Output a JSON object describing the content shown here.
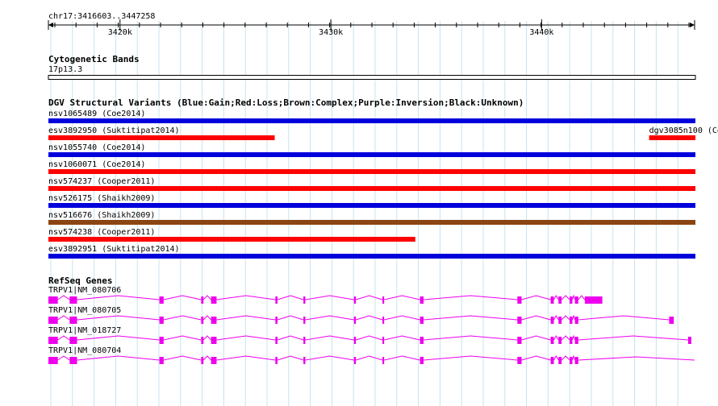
{
  "locus": {
    "label": "chr17:3416603..3447258",
    "start": 3416603,
    "end": 3447258
  },
  "ruler": {
    "ticks": [
      {
        "label": "3420k",
        "pos": 3420000
      },
      {
        "label": "3430k",
        "pos": 3430000
      },
      {
        "label": "3440k",
        "pos": 3440000
      }
    ]
  },
  "cytoband": {
    "title": "Cytogenetic Bands",
    "band": "17p13.3"
  },
  "dgv": {
    "title": "DGV Structural Variants (Blue:Gain;Red:Loss;Brown:Complex;Purple:Inversion;Black:Unknown)",
    "legend_colors": {
      "gain": "#0000dd",
      "loss": "#ff0000",
      "complex": "#8b4513",
      "inversion": "#800080",
      "unknown": "#000000"
    },
    "variants": [
      {
        "label": "nsv1065489 (Coe2014)",
        "type": "gain",
        "start": 3416603,
        "end": 3447258
      },
      {
        "label": "esv3892950 (Suktitipat2014)",
        "type": "loss",
        "start": 3416603,
        "end": 3427300
      },
      {
        "label": "dgv3085n100 (Co",
        "type": "loss",
        "start": 3445100,
        "end": 3447258
      },
      {
        "label": "nsv1055740 (Coe2014)",
        "type": "gain",
        "start": 3416603,
        "end": 3447258
      },
      {
        "label": "nsv1060071 (Coe2014)",
        "type": "loss",
        "start": 3416603,
        "end": 3447258
      },
      {
        "label": "nsv574237 (Cooper2011)",
        "type": "loss",
        "start": 3416603,
        "end": 3447258
      },
      {
        "label": "nsv526175 (Shaikh2009)",
        "type": "gain",
        "start": 3416603,
        "end": 3447258
      },
      {
        "label": "nsv516676 (Shaikh2009)",
        "type": "complex",
        "start": 3416603,
        "end": 3447258
      },
      {
        "label": "nsv574238 (Cooper2011)",
        "type": "loss",
        "start": 3416603,
        "end": 3433970
      },
      {
        "label": "esv3892951 (Suktitipat2014)",
        "type": "gain",
        "start": 3416603,
        "end": 3447258
      }
    ]
  },
  "refseq": {
    "title": "RefSeq Genes",
    "color": "#ee00ee",
    "genes": [
      {
        "label": "TRPV1|NM_080706",
        "start": 3416603,
        "end": 3442880,
        "exons": [
          [
            3416603,
            3417050
          ],
          [
            3417610,
            3417960
          ],
          [
            3421870,
            3422070
          ],
          [
            3423850,
            3423960
          ],
          [
            3424320,
            3424580
          ],
          [
            3427370,
            3427470
          ],
          [
            3428700,
            3428790
          ],
          [
            3431100,
            3431190
          ],
          [
            3432450,
            3432530
          ],
          [
            3434230,
            3434400
          ],
          [
            3438850,
            3439050
          ],
          [
            3440430,
            3440580
          ],
          [
            3440800,
            3440950
          ],
          [
            3441330,
            3441460
          ],
          [
            3441580,
            3441740
          ],
          [
            3442050,
            3442880
          ]
        ]
      },
      {
        "label": "TRPV1|NM_080705",
        "start": 3416603,
        "end": 3446270,
        "exons": [
          [
            3416603,
            3417050
          ],
          [
            3417610,
            3417960
          ],
          [
            3421870,
            3422070
          ],
          [
            3423850,
            3423960
          ],
          [
            3424320,
            3424580
          ],
          [
            3427370,
            3427470
          ],
          [
            3428700,
            3428790
          ],
          [
            3431100,
            3431190
          ],
          [
            3432450,
            3432530
          ],
          [
            3434230,
            3434400
          ],
          [
            3438850,
            3439050
          ],
          [
            3440430,
            3440580
          ],
          [
            3440800,
            3440950
          ],
          [
            3441330,
            3441460
          ],
          [
            3441580,
            3441740
          ],
          [
            3446050,
            3446270
          ]
        ]
      },
      {
        "label": "TRPV1|NM_018727",
        "start": 3416603,
        "end": 3447100,
        "exons": [
          [
            3416603,
            3417050
          ],
          [
            3417610,
            3417960
          ],
          [
            3421870,
            3422070
          ],
          [
            3423850,
            3423960
          ],
          [
            3424320,
            3424580
          ],
          [
            3427370,
            3427470
          ],
          [
            3428700,
            3428790
          ],
          [
            3431100,
            3431190
          ],
          [
            3432450,
            3432530
          ],
          [
            3434230,
            3434400
          ],
          [
            3438850,
            3439050
          ],
          [
            3440430,
            3440580
          ],
          [
            3440800,
            3440950
          ],
          [
            3441330,
            3441460
          ],
          [
            3441580,
            3441740
          ],
          [
            3446950,
            3447100
          ]
        ]
      },
      {
        "label": "TRPV1|NM_080704",
        "start": 3416603,
        "end": 3447258,
        "exons": [
          [
            3416603,
            3417050
          ],
          [
            3417610,
            3417960
          ],
          [
            3421870,
            3422070
          ],
          [
            3423850,
            3423960
          ],
          [
            3424320,
            3424580
          ],
          [
            3427370,
            3427470
          ],
          [
            3428700,
            3428790
          ],
          [
            3431100,
            3431190
          ],
          [
            3432450,
            3432530
          ],
          [
            3434230,
            3434400
          ],
          [
            3438850,
            3439050
          ],
          [
            3440430,
            3440580
          ],
          [
            3440800,
            3440950
          ],
          [
            3441330,
            3441460
          ],
          [
            3441580,
            3441740
          ]
        ]
      }
    ]
  }
}
